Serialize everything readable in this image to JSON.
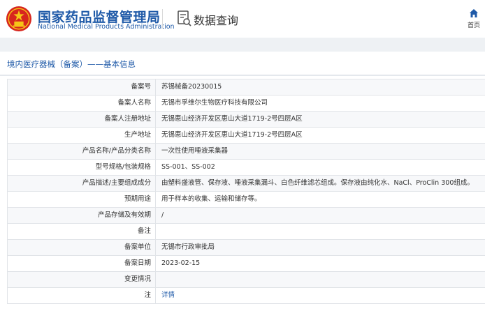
{
  "header": {
    "title_cn": "国家药品监督管理局",
    "title_en": "National Medical Products Administration",
    "section": "数据查询",
    "home_label": "首页"
  },
  "breadcrumb": {
    "text": "境内医疗器械（备案）——基本信息"
  },
  "table": {
    "rows": [
      {
        "label": "备案号",
        "value": "苏锡械备20230015"
      },
      {
        "label": "备案人名称",
        "value": "无锡市孚维尔生物医疗科技有限公司"
      },
      {
        "label": "备案人注册地址",
        "value": "无锡惠山经济开发区惠山大道1719-2号四层A区"
      },
      {
        "label": "生产地址",
        "value": "无锡惠山经济开发区惠山大道1719-2号四层A区"
      },
      {
        "label": "产品名称/产品分类名称",
        "value": "一次性使用唾液采集器"
      },
      {
        "label": "型号规格/包装规格",
        "value": "SS-001、SS-002"
      },
      {
        "label": "产品描述/主要组成成分",
        "value": "由塑料盛液管、保存液、唾液采集漏斗、白色纤维滤芯组成。保存液由纯化水、NaCl、ProClin 300组成。"
      },
      {
        "label": "预期用途",
        "value": "用于样本的收集、运输和储存等。"
      },
      {
        "label": "产品存储及有效期",
        "value": "/"
      },
      {
        "label": "备注",
        "value": ""
      },
      {
        "label": "备案单位",
        "value": "无锡市行政审批局"
      },
      {
        "label": "备案日期",
        "value": "2023-02-15"
      },
      {
        "label": "变更情况",
        "value": ""
      },
      {
        "label": "注",
        "value": "详情"
      }
    ]
  },
  "colors": {
    "brand_blue": "#1f5aa8",
    "emblem_red": "#d7261e",
    "emblem_gold": "#f5c518"
  }
}
